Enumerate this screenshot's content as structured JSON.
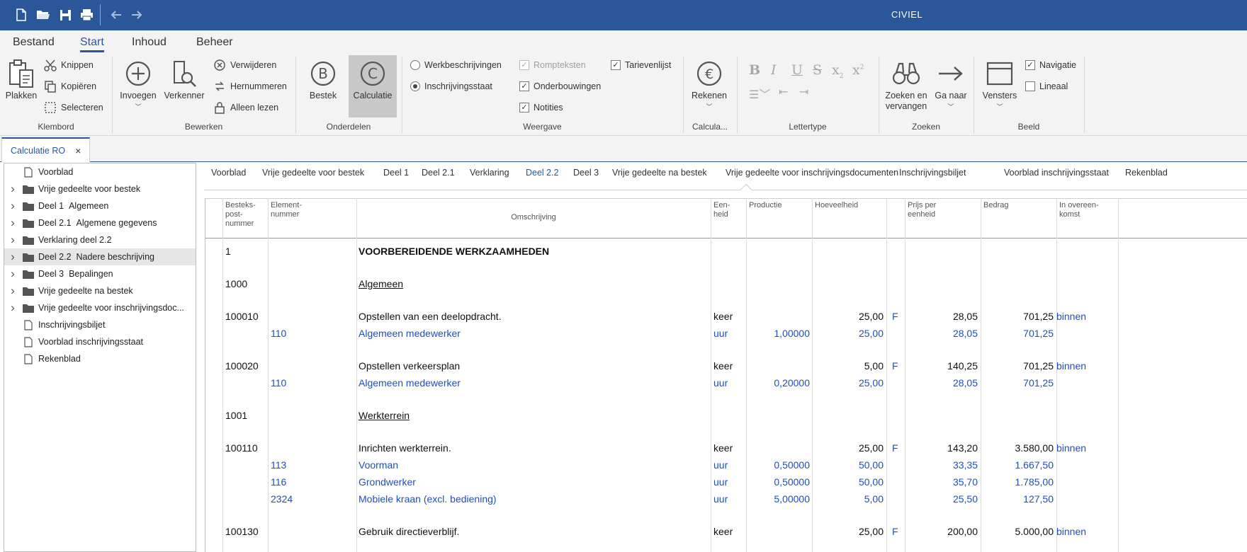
{
  "app": {
    "title": "CIVIEL"
  },
  "menu": {
    "tabs": [
      "Bestand",
      "Start",
      "Inhoud",
      "Beheer"
    ],
    "active": "Start"
  },
  "ribbon": {
    "klembord": {
      "label": "Klembord",
      "plakken": "Plakken",
      "knippen": "Knippen",
      "kopieren": "Kopiëren",
      "selecteren": "Selecteren"
    },
    "bewerken": {
      "label": "Bewerken",
      "invoegen": "Invoegen",
      "verkenner": "Verkenner",
      "verwijderen": "Verwijderen",
      "hernummeren": "Hernummeren",
      "alleen_lezen": "Alleen lezen"
    },
    "onderdelen": {
      "label": "Onderdelen",
      "bestek": "Bestek",
      "calculatie": "Calculatie"
    },
    "weergave": {
      "label": "Weergave",
      "werkbeschrijvingen": "Werkbeschrijvingen",
      "inschrijvingsstaat": "Inschrijvingsstaat",
      "rompteksten": "Rompteksten",
      "onderbouwingen": "Onderbouwingen",
      "notities": "Notities",
      "tarievenlijst": "Tarievenlijst"
    },
    "calculatie": {
      "label": "Calcula...",
      "rekenen": "Rekenen"
    },
    "lettertype": {
      "label": "Lettertype"
    },
    "zoeken": {
      "label": "Zoeken",
      "zoeken_en": "Zoeken en",
      "vervangen": "vervangen",
      "ga_naar": "Ga naar"
    },
    "beeld": {
      "label": "Beeld",
      "vensters": "Vensters",
      "navigatie": "Navigatie",
      "lineaal": "Lineaal"
    }
  },
  "doc_tab": {
    "label": "Calculatie RO",
    "close": "×"
  },
  "tree": [
    {
      "label": "Voorblad",
      "type": "file",
      "expandable": false
    },
    {
      "label": "Vrije gedeelte voor bestek",
      "type": "folder",
      "expandable": true
    },
    {
      "label": "Deel 1  Algemeen",
      "type": "folder",
      "expandable": true
    },
    {
      "label": "Deel 2.1  Algemene gegevens",
      "type": "folder",
      "expandable": true
    },
    {
      "label": "Verklaring deel 2.2",
      "type": "folder",
      "expandable": true
    },
    {
      "label": "Deel 2.2  Nadere beschrijving",
      "type": "folder",
      "expandable": true,
      "selected": true
    },
    {
      "label": "Deel 3  Bepalingen",
      "type": "folder",
      "expandable": true
    },
    {
      "label": "Vrije gedeelte na bestek",
      "type": "folder",
      "expandable": true
    },
    {
      "label": "Vrije gedeelte voor inschrijvingsdoc...",
      "type": "folder",
      "expandable": true
    },
    {
      "label": "Inschrijvingsbiljet",
      "type": "file",
      "expandable": false
    },
    {
      "label": "Voorblad inschrijvingsstaat",
      "type": "file",
      "expandable": false
    },
    {
      "label": "Rekenblad",
      "type": "file",
      "expandable": false
    }
  ],
  "sections": [
    "Voorblad",
    "Vrije gedeelte voor bestek",
    "Deel 1",
    "Deel 2.1",
    "Verklaring",
    "Deel 2.2",
    "Deel 3",
    "Vrije gedeelte na bestek",
    "Vrije gedeelte voor inschrijvingsdocumenten",
    "Inschrijvingsbiljet",
    "Voorblad inschrijvingsstaat",
    "Rekenblad"
  ],
  "active_section": "Deel 2.2",
  "grid": {
    "headers": {
      "post": [
        "Besteks-",
        "post-",
        "nummer"
      ],
      "element": [
        "Element-",
        "nummer"
      ],
      "omschrijving": "Omschrijving",
      "eenheid": [
        "Een-",
        "heid"
      ],
      "productie": "Productie",
      "hoeveelheid": "Hoeveelheid",
      "prijs": [
        "Prijs per",
        "eenheid"
      ],
      "bedrag": "Bedrag",
      "overeenkomst": [
        "In overeen-",
        "komst"
      ]
    },
    "rows": [
      {
        "kind": "chapter",
        "post": "1",
        "omschrijving": "VOORBEREIDENDE WERKZAAMHEDEN"
      },
      {
        "kind": "paragraph",
        "post": "1000",
        "omschrijving": "Algemeen"
      },
      {
        "kind": "post",
        "post": "100010",
        "omschrijving": "Opstellen van een deelopdracht.",
        "eenheid": "keer",
        "hoeveelheid": "25,00",
        "flag": "F",
        "prijs": "28,05",
        "bedrag": "701,25",
        "overeenkomst": "binnen"
      },
      {
        "kind": "element",
        "element": "110",
        "omschrijving": "Algemeen medewerker",
        "eenheid": "uur",
        "productie": "1,00000",
        "hoeveelheid": "25,00",
        "prijs": "28,05",
        "bedrag": "701,25"
      },
      {
        "kind": "post",
        "post": "100020",
        "omschrijving": "Opstellen verkeersplan",
        "eenheid": "keer",
        "hoeveelheid": "5,00",
        "flag": "F",
        "prijs": "140,25",
        "bedrag": "701,25",
        "overeenkomst": "binnen"
      },
      {
        "kind": "element",
        "element": "110",
        "omschrijving": "Algemeen medewerker",
        "eenheid": "uur",
        "productie": "0,20000",
        "hoeveelheid": "25,00",
        "prijs": "28,05",
        "bedrag": "701,25"
      },
      {
        "kind": "paragraph",
        "post": "1001",
        "omschrijving": "Werkterrein"
      },
      {
        "kind": "post",
        "post": "100110",
        "omschrijving": "Inrichten werkterrein.",
        "eenheid": "keer",
        "hoeveelheid": "25,00",
        "flag": "F",
        "prijs": "143,20",
        "bedrag": "3.580,00",
        "overeenkomst": "binnen"
      },
      {
        "kind": "element",
        "element": "113",
        "omschrijving": "Voorman",
        "eenheid": "uur",
        "productie": "0,50000",
        "hoeveelheid": "50,00",
        "prijs": "33,35",
        "bedrag": "1.667,50"
      },
      {
        "kind": "element",
        "element": "116",
        "omschrijving": "Grondwerker",
        "eenheid": "uur",
        "productie": "0,50000",
        "hoeveelheid": "50,00",
        "prijs": "35,70",
        "bedrag": "1.785,00"
      },
      {
        "kind": "element",
        "element": "2324",
        "omschrijving": "Mobiele kraan (excl. bediening)",
        "eenheid": "uur",
        "productie": "5,00000",
        "hoeveelheid": "5,00",
        "prijs": "25,50",
        "bedrag": "127,50"
      },
      {
        "kind": "post",
        "post": "100130",
        "omschrijving": "Gebruik directieverblijf.",
        "eenheid": "keer",
        "hoeveelheid": "25,00",
        "flag": "F",
        "prijs": "200,00",
        "bedrag": "5.000,00",
        "overeenkomst": "binnen"
      }
    ]
  }
}
